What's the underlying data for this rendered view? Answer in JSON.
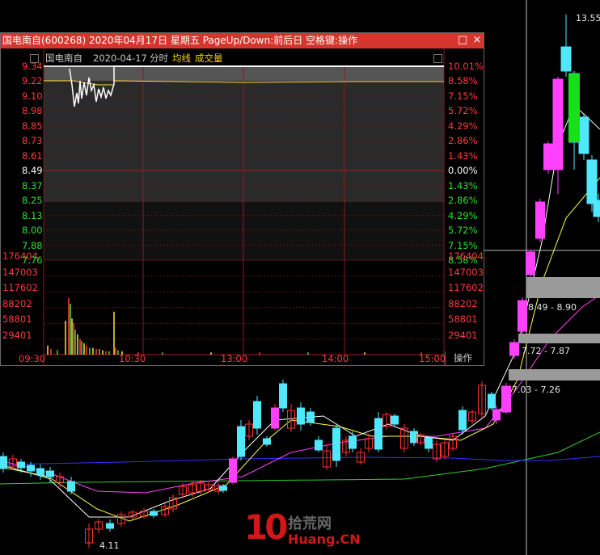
{
  "window": {
    "title": "国电南自(600268) 2020年04月17日 星期五 PageUp/Down:前后日 空格键:操作",
    "stock_name": "国电南自",
    "date": "2020-04-17",
    "mode": "分时",
    "avg_line_label": "均线",
    "volume_label": "成交量",
    "action_label": "操作",
    "close_btn": "×",
    "max_btn": "□"
  },
  "price_axis": {
    "left_up": [
      "9.34",
      "9.22",
      "9.10",
      "8.98",
      "8.85",
      "8.73",
      "8.61"
    ],
    "base": "8.49",
    "left_down": [
      "8.37",
      "8.25",
      "8.13",
      "8.00",
      "7.88",
      "7.76"
    ],
    "right_up": [
      "10.01%",
      "8.58%",
      "7.15%",
      "5.72%",
      "4.29%",
      "2.86%",
      "1.43%"
    ],
    "right_base": "0.00%",
    "right_down": [
      "1.43%",
      "2.86%",
      "4.29%",
      "5.72%",
      "7.15%",
      "8.58%"
    ]
  },
  "volume_axis": [
    "176404",
    "147003",
    "117602",
    "88202",
    "58801",
    "29401"
  ],
  "time_axis": [
    "09:30",
    "10:30",
    "13:00",
    "14:00",
    "15:00"
  ],
  "annotations": {
    "high": "13.55",
    "low": "4.11",
    "range1": "8.49 - 8.90",
    "range2": "7.72 - 7.87",
    "range3": "7.03 - 7.26"
  },
  "watermark": {
    "num": "10",
    "cn": "拾荒网",
    "en": "Huang.CN"
  },
  "colors": {
    "up": "#ff40ff",
    "up_outline": "#ff3030",
    "down": "#50e8ff",
    "title_bar": "#d4352d",
    "ma1": "#ffffff",
    "ma2": "#ffff40",
    "ma3": "#ff40ff",
    "ma4": "#30d030",
    "ma5": "#3030ff"
  }
}
